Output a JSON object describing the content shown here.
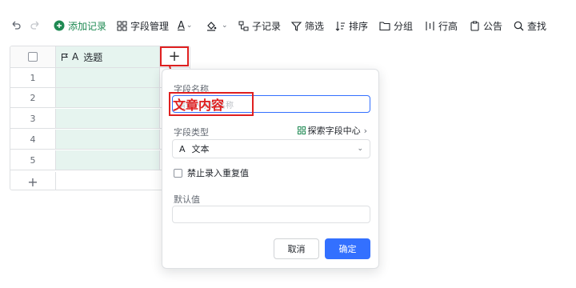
{
  "toolbar": {
    "undo_icon": "undo-icon",
    "redo_icon": "redo-icon",
    "add_record": "添加记录",
    "field_manage": "字段管理",
    "sub_record": "子记录",
    "filter": "筛选",
    "sort": "排序",
    "group": "分组",
    "row_height": "行高",
    "notice": "公告",
    "search": "查找",
    "font_letter": "A"
  },
  "grid": {
    "header_title": "选题",
    "header_type_letter": "A",
    "rows": [
      "1",
      "2",
      "3",
      "4",
      "5"
    ],
    "add_row_symbol": "+",
    "add_column_symbol": "+"
  },
  "popup": {
    "field_name_label": "字段名称",
    "field_name_placeholder": "请输入字段名称",
    "annotation_text": "文章内容",
    "field_type_label": "字段类型",
    "explore_link": "探索字段中心",
    "field_type_value": "文本",
    "field_type_letter": "A",
    "no_duplicate_label": "禁止录入重复值",
    "default_label": "默认值",
    "cancel": "取消",
    "confirm": "确定"
  },
  "colors": {
    "accent": "#3370ff",
    "add_green": "#1f8a53",
    "annotation_red": "#e02020",
    "title_column_bg": "#e6f4ef"
  }
}
